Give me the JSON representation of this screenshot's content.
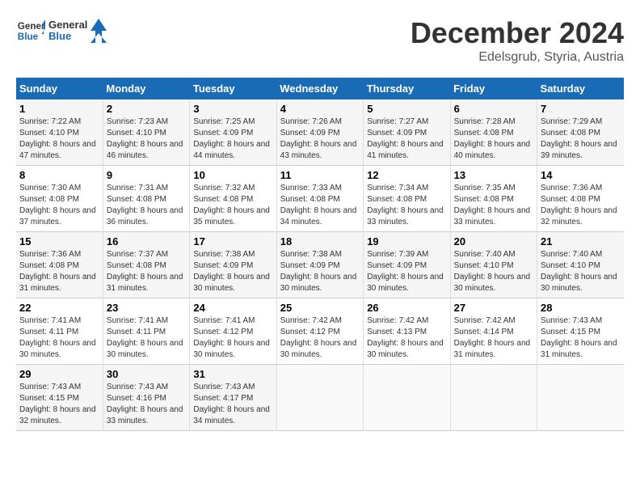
{
  "header": {
    "logo_line1": "General",
    "logo_line2": "Blue",
    "month": "December 2024",
    "location": "Edelsgrub, Styria, Austria"
  },
  "days_of_week": [
    "Sunday",
    "Monday",
    "Tuesday",
    "Wednesday",
    "Thursday",
    "Friday",
    "Saturday"
  ],
  "weeks": [
    [
      {
        "day": "1",
        "sunrise": "7:22 AM",
        "sunset": "4:10 PM",
        "daylight": "8 hours and 47 minutes."
      },
      {
        "day": "2",
        "sunrise": "7:23 AM",
        "sunset": "4:10 PM",
        "daylight": "8 hours and 46 minutes."
      },
      {
        "day": "3",
        "sunrise": "7:25 AM",
        "sunset": "4:09 PM",
        "daylight": "8 hours and 44 minutes."
      },
      {
        "day": "4",
        "sunrise": "7:26 AM",
        "sunset": "4:09 PM",
        "daylight": "8 hours and 43 minutes."
      },
      {
        "day": "5",
        "sunrise": "7:27 AM",
        "sunset": "4:09 PM",
        "daylight": "8 hours and 41 minutes."
      },
      {
        "day": "6",
        "sunrise": "7:28 AM",
        "sunset": "4:08 PM",
        "daylight": "8 hours and 40 minutes."
      },
      {
        "day": "7",
        "sunrise": "7:29 AM",
        "sunset": "4:08 PM",
        "daylight": "8 hours and 39 minutes."
      }
    ],
    [
      {
        "day": "8",
        "sunrise": "7:30 AM",
        "sunset": "4:08 PM",
        "daylight": "8 hours and 37 minutes."
      },
      {
        "day": "9",
        "sunrise": "7:31 AM",
        "sunset": "4:08 PM",
        "daylight": "8 hours and 36 minutes."
      },
      {
        "day": "10",
        "sunrise": "7:32 AM",
        "sunset": "4:08 PM",
        "daylight": "8 hours and 35 minutes."
      },
      {
        "day": "11",
        "sunrise": "7:33 AM",
        "sunset": "4:08 PM",
        "daylight": "8 hours and 34 minutes."
      },
      {
        "day": "12",
        "sunrise": "7:34 AM",
        "sunset": "4:08 PM",
        "daylight": "8 hours and 33 minutes."
      },
      {
        "day": "13",
        "sunrise": "7:35 AM",
        "sunset": "4:08 PM",
        "daylight": "8 hours and 33 minutes."
      },
      {
        "day": "14",
        "sunrise": "7:36 AM",
        "sunset": "4:08 PM",
        "daylight": "8 hours and 32 minutes."
      }
    ],
    [
      {
        "day": "15",
        "sunrise": "7:36 AM",
        "sunset": "4:08 PM",
        "daylight": "8 hours and 31 minutes."
      },
      {
        "day": "16",
        "sunrise": "7:37 AM",
        "sunset": "4:08 PM",
        "daylight": "8 hours and 31 minutes."
      },
      {
        "day": "17",
        "sunrise": "7:38 AM",
        "sunset": "4:09 PM",
        "daylight": "8 hours and 30 minutes."
      },
      {
        "day": "18",
        "sunrise": "7:38 AM",
        "sunset": "4:09 PM",
        "daylight": "8 hours and 30 minutes."
      },
      {
        "day": "19",
        "sunrise": "7:39 AM",
        "sunset": "4:09 PM",
        "daylight": "8 hours and 30 minutes."
      },
      {
        "day": "20",
        "sunrise": "7:40 AM",
        "sunset": "4:10 PM",
        "daylight": "8 hours and 30 minutes."
      },
      {
        "day": "21",
        "sunrise": "7:40 AM",
        "sunset": "4:10 PM",
        "daylight": "8 hours and 30 minutes."
      }
    ],
    [
      {
        "day": "22",
        "sunrise": "7:41 AM",
        "sunset": "4:11 PM",
        "daylight": "8 hours and 30 minutes."
      },
      {
        "day": "23",
        "sunrise": "7:41 AM",
        "sunset": "4:11 PM",
        "daylight": "8 hours and 30 minutes."
      },
      {
        "day": "24",
        "sunrise": "7:41 AM",
        "sunset": "4:12 PM",
        "daylight": "8 hours and 30 minutes."
      },
      {
        "day": "25",
        "sunrise": "7:42 AM",
        "sunset": "4:12 PM",
        "daylight": "8 hours and 30 minutes."
      },
      {
        "day": "26",
        "sunrise": "7:42 AM",
        "sunset": "4:13 PM",
        "daylight": "8 hours and 30 minutes."
      },
      {
        "day": "27",
        "sunrise": "7:42 AM",
        "sunset": "4:14 PM",
        "daylight": "8 hours and 31 minutes."
      },
      {
        "day": "28",
        "sunrise": "7:43 AM",
        "sunset": "4:15 PM",
        "daylight": "8 hours and 31 minutes."
      }
    ],
    [
      {
        "day": "29",
        "sunrise": "7:43 AM",
        "sunset": "4:15 PM",
        "daylight": "8 hours and 32 minutes."
      },
      {
        "day": "30",
        "sunrise": "7:43 AM",
        "sunset": "4:16 PM",
        "daylight": "8 hours and 33 minutes."
      },
      {
        "day": "31",
        "sunrise": "7:43 AM",
        "sunset": "4:17 PM",
        "daylight": "8 hours and 34 minutes."
      },
      null,
      null,
      null,
      null
    ]
  ]
}
